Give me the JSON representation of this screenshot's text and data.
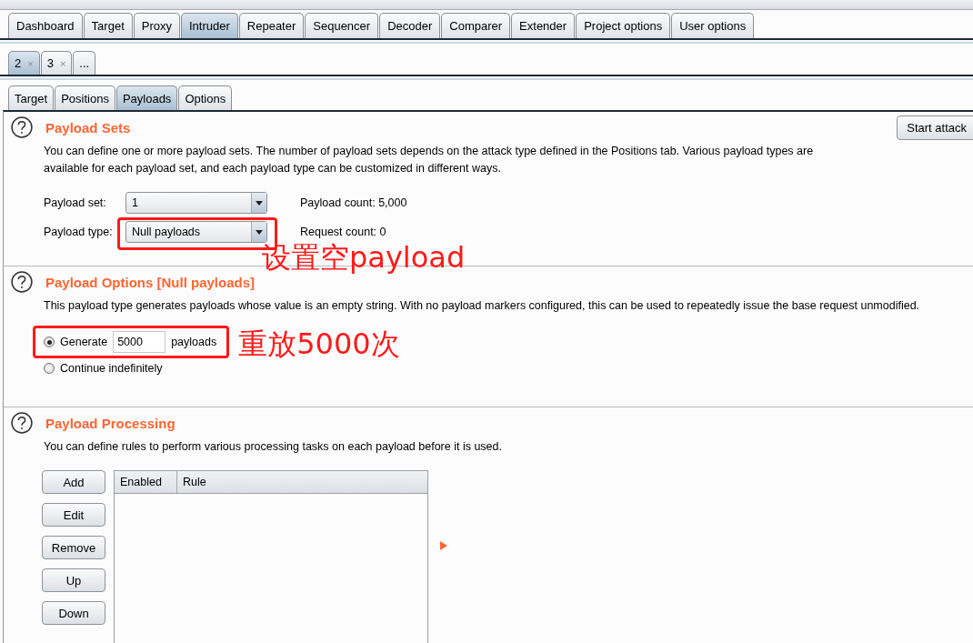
{
  "main_tabs": [
    {
      "label": "Dashboard",
      "selected": false
    },
    {
      "label": "Target",
      "selected": false
    },
    {
      "label": "Proxy",
      "selected": false
    },
    {
      "label": "Intruder",
      "selected": true
    },
    {
      "label": "Repeater",
      "selected": false
    },
    {
      "label": "Sequencer",
      "selected": false
    },
    {
      "label": "Decoder",
      "selected": false
    },
    {
      "label": "Comparer",
      "selected": false
    },
    {
      "label": "Extender",
      "selected": false
    },
    {
      "label": "Project options",
      "selected": false
    },
    {
      "label": "User options",
      "selected": false
    }
  ],
  "attack_tabs": [
    {
      "label": "2",
      "close": "×",
      "selected": true
    },
    {
      "label": "3",
      "close": "×",
      "selected": false
    },
    {
      "label": "...",
      "selected": false
    }
  ],
  "sub_tabs": [
    {
      "label": "Target",
      "selected": false
    },
    {
      "label": "Positions",
      "selected": false
    },
    {
      "label": "Payloads",
      "selected": true
    },
    {
      "label": "Options",
      "selected": false
    }
  ],
  "payload_sets": {
    "title": "Payload Sets",
    "description": "You can define one or more payload sets. The number of payload sets depends on the attack type defined in the Positions tab. Various payload types are available for each payload set, and each payload type can be customized in different ways.",
    "start_button": "Start attack",
    "payload_set": {
      "label": "Payload set:",
      "value": "1"
    },
    "payload_type": {
      "label": "Payload type:",
      "value": "Null payloads"
    },
    "payload_count": {
      "label": "Payload count:",
      "value": "5,000"
    },
    "request_count": {
      "label": "Request count:",
      "value": "0"
    },
    "annotation": "设置空payload"
  },
  "payload_options": {
    "title": "Payload Options [Null payloads]",
    "description": "This payload type generates payloads whose value is an empty string. With no payload markers configured, this can be used to repeatedly issue the base request unmodified.",
    "options": [
      {
        "kind": "count",
        "label": "Generate",
        "value": "5000",
        "suffix": "payloads",
        "selected": true
      },
      {
        "kind": "plain",
        "label": "Continue indefinitely",
        "selected": false
      }
    ],
    "annotation": "重放5000次"
  },
  "payload_processing": {
    "title": "Payload Processing",
    "description": "You can define rules to perform various processing tasks on each payload before it is used.",
    "buttons": [
      "Add",
      "Edit",
      "Remove",
      "Up",
      "Down"
    ],
    "columns": [
      "Enabled",
      "Rule"
    ]
  }
}
